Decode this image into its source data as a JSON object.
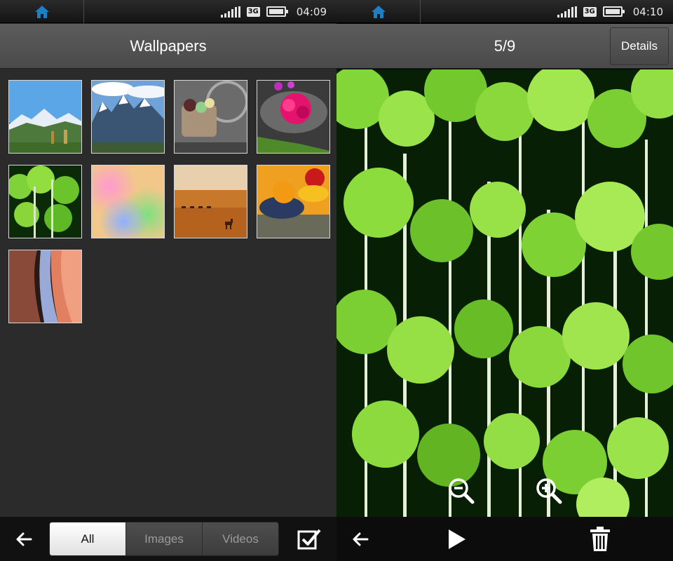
{
  "left": {
    "status": {
      "time": "04:09",
      "network": "3G"
    },
    "title": "Wallpapers",
    "tabs": [
      {
        "label": "All",
        "selected": true
      },
      {
        "label": "Images",
        "selected": false
      },
      {
        "label": "Videos",
        "selected": false
      }
    ],
    "thumbnails": [
      {
        "subject": "mountain-valley"
      },
      {
        "subject": "snowy-peaks"
      },
      {
        "subject": "bicycle-basket"
      },
      {
        "subject": "pink-flowers-bowl"
      },
      {
        "subject": "aspen-forest"
      },
      {
        "subject": "colorful-blur"
      },
      {
        "subject": "desert-camels"
      },
      {
        "subject": "fruit-bowl"
      },
      {
        "subject": "canyon"
      }
    ]
  },
  "right": {
    "status": {
      "time": "04:10",
      "network": "3G"
    },
    "counter": "5/9",
    "details_label": "Details"
  },
  "colors": {
    "home_icon": "#1b7fc4",
    "title_bar": "#555555",
    "background": "#2b2b2b"
  }
}
